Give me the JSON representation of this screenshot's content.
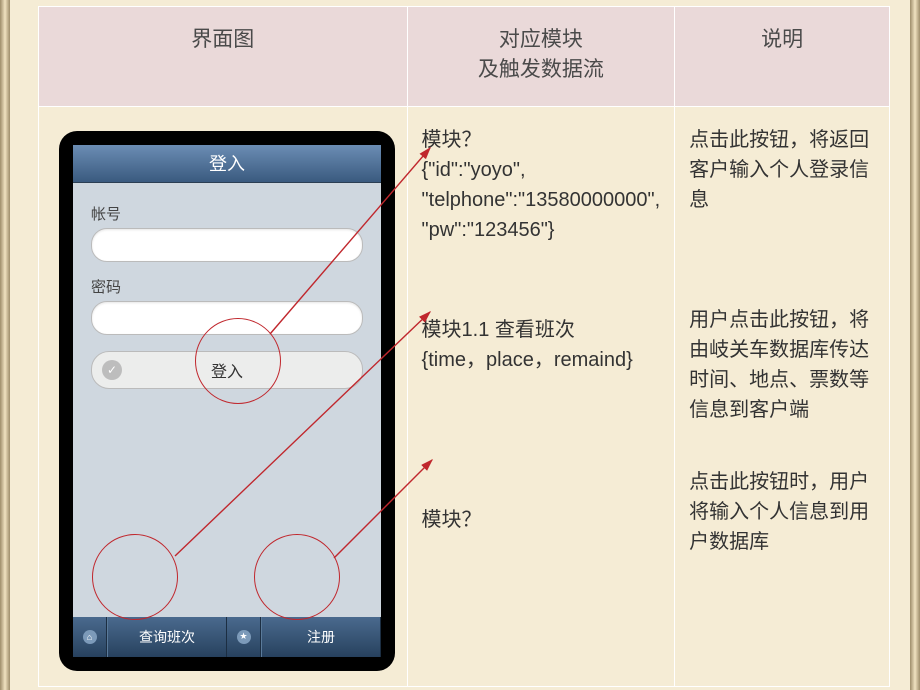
{
  "header": {
    "col1": "界面图",
    "col2": "对应模块\n及触发数据流",
    "col3": "说明"
  },
  "phone": {
    "title": "登入",
    "label_account": "帐号",
    "label_password": "密码",
    "login_button": "登入",
    "footer_query": "查询班次",
    "footer_register": "注册"
  },
  "modules": {
    "m1_line1": "模块？",
    "m1_line2": "{\"id\":\"yoyo\",",
    "m1_line3": "\"telphone\":\"13580000000\",",
    "m1_line4": "\"pw\":\"123456\"}",
    "m2_line1": "模块1.1 查看班次",
    "m2_line2": "{time，place，remaind}",
    "m3_line1": "模块？"
  },
  "explain": {
    "e1": "点击此按钮，将返回客户输入个人登录信息",
    "e2": "用户点击此按钮，将由岐关车数据库传达时间、地点、票数等信息到客户端",
    "e3": "点击此按钮时，用户将输入个人信息到用户数据库"
  }
}
